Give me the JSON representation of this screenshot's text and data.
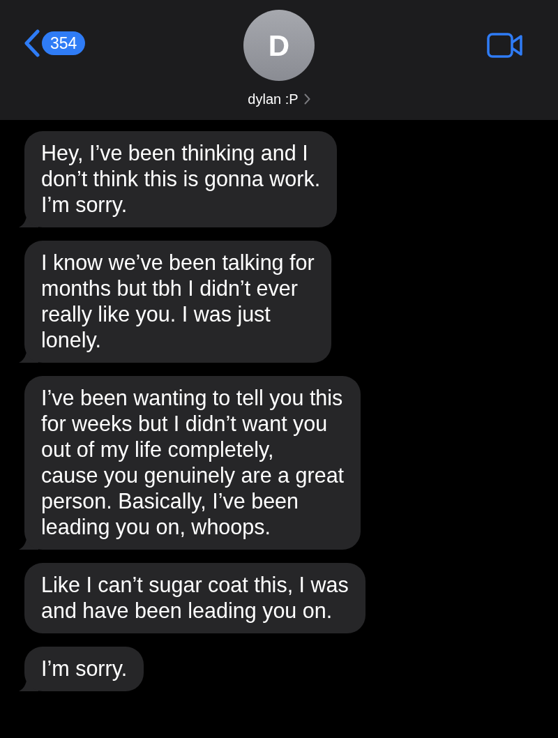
{
  "header": {
    "unread_count": "354",
    "avatar_initial": "D",
    "contact_name": "dylan :P"
  },
  "messages": [
    {
      "text": "Hey, I’ve been thinking and I\ndon’t think this is gonna work.\nI’m sorry.",
      "tail": true
    },
    {
      "text": "I know we’ve been talking for\nmonths but tbh I didn’t ever\nreally like you. I was just\nlonely.",
      "tail": true
    },
    {
      "text": "I’ve been wanting to tell you this\nfor weeks but I didn’t want you\nout of my life completely,\ncause you genuinely are a great\nperson. Basically, I’ve been\nleading you on, whoops.",
      "tail": true
    },
    {
      "text": "Like I can’t sugar coat this, I was\nand have been leading you on.",
      "tail": false
    },
    {
      "text": "I’m sorry.",
      "tail": true
    }
  ]
}
